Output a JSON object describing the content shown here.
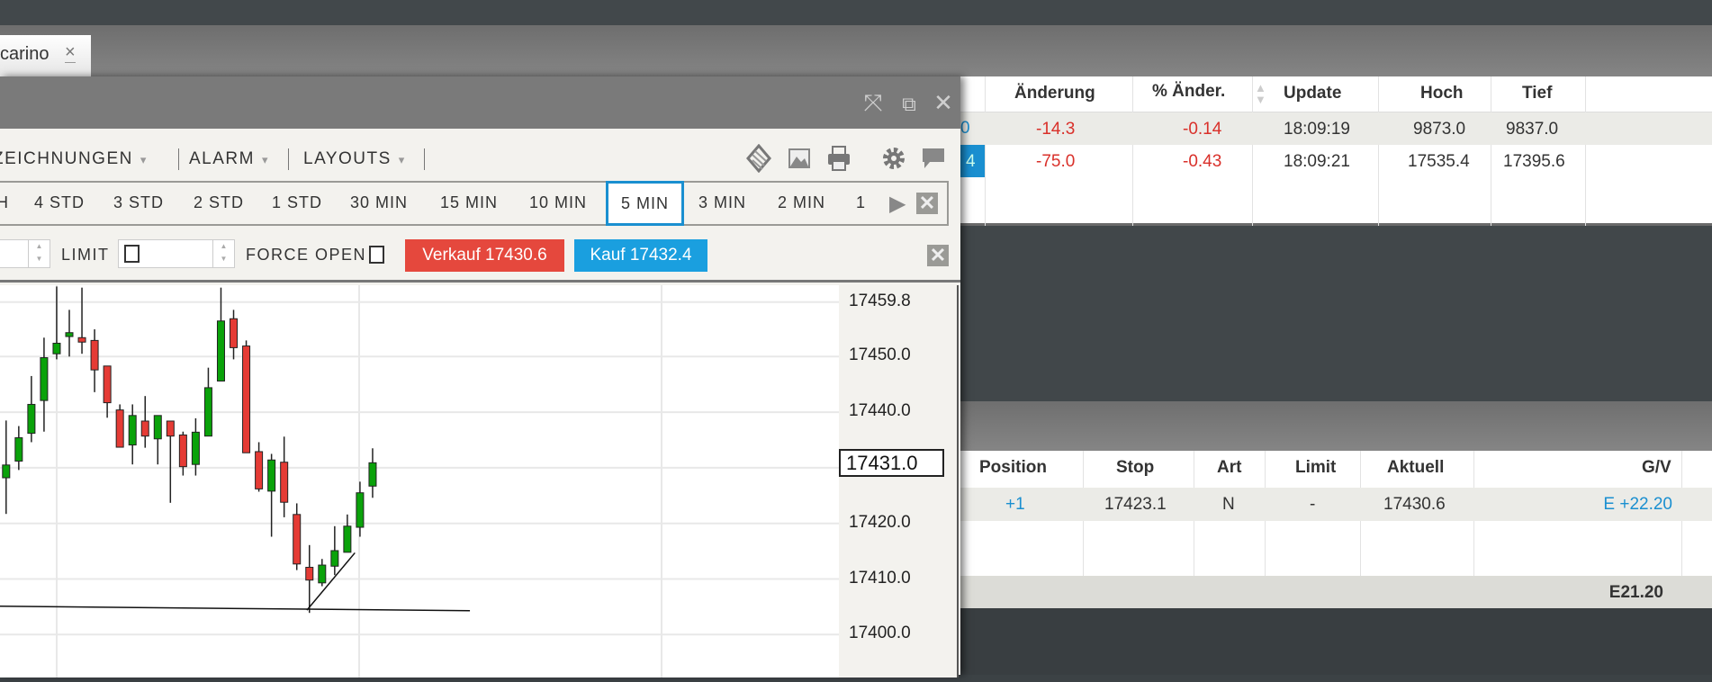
{
  "tab": {
    "label": "carino",
    "close": "×"
  },
  "window": {
    "icons": [
      "expand-icon",
      "popout-icon",
      "close-icon"
    ]
  },
  "toolbar": {
    "menus": [
      {
        "label": "ZEICHNUNGEN"
      },
      {
        "label": "ALARM"
      },
      {
        "label": "LAYOUTS"
      }
    ],
    "caret": "▾",
    "icons": [
      "indicator-icon",
      "image-icon",
      "print-icon",
      "gear-icon",
      "comment-icon"
    ]
  },
  "timeframes": {
    "items": [
      "H",
      "4 STD",
      "3 STD",
      "2 STD",
      "1 STD",
      "30 MIN",
      "15 MIN",
      "10 MIN",
      "5 MIN",
      "3 MIN",
      "2 MIN",
      "1"
    ],
    "selected": "5 MIN"
  },
  "order": {
    "limit_label": "LIMIT",
    "force_open_label": "FORCE OPEN",
    "sell_label": "Verkauf 17430.6",
    "buy_label": "Kauf 17432.4",
    "sell_color": "#e5483d",
    "buy_color": "#1a9fdf"
  },
  "chart_data": {
    "type": "candlestick",
    "interval": "5 MIN",
    "y_ticks": [
      "17459.8",
      "17450.0",
      "17440.0",
      "17430.0",
      "17420.0",
      "17410.0",
      "17400.0"
    ],
    "y_tick_labels": [
      "17459.8",
      "17450.0",
      "17440.0",
      "17420.0",
      "17410.0",
      "17400.0"
    ],
    "last_price": "17431.0",
    "ylim": [
      17395,
      17465
    ],
    "grid": true,
    "up_color": "#0aa20a",
    "down_color": "#e53b35",
    "candles": [
      {
        "o": 17428.2,
        "h": 17438.5,
        "l": 17421.7,
        "c": 17430.5
      },
      {
        "o": 17431.2,
        "h": 17437.5,
        "l": 17429.6,
        "c": 17435.4
      },
      {
        "o": 17436.2,
        "h": 17446.5,
        "l": 17434.6,
        "c": 17441.4
      },
      {
        "o": 17442.1,
        "h": 17453.4,
        "l": 17436.5,
        "c": 17449.8
      },
      {
        "o": 17450.5,
        "h": 17462.6,
        "l": 17449.5,
        "c": 17452.4
      },
      {
        "o": 17453.6,
        "h": 17458.4,
        "l": 17450.0,
        "c": 17454.3
      },
      {
        "o": 17453.4,
        "h": 17462.4,
        "l": 17450.5,
        "c": 17452.6
      },
      {
        "o": 17452.9,
        "h": 17454.9,
        "l": 17443.6,
        "c": 17447.6
      },
      {
        "o": 17448.3,
        "h": 17448.3,
        "l": 17439.0,
        "c": 17441.7
      },
      {
        "o": 17440.4,
        "h": 17441.4,
        "l": 17433.7,
        "c": 17433.7
      },
      {
        "o": 17434.1,
        "h": 17441.4,
        "l": 17430.6,
        "c": 17439.4
      },
      {
        "o": 17438.4,
        "h": 17442.9,
        "l": 17433.6,
        "c": 17435.7
      },
      {
        "o": 17435.2,
        "h": 17439.4,
        "l": 17430.6,
        "c": 17439.4
      },
      {
        "o": 17438.4,
        "h": 17438.4,
        "l": 17423.7,
        "c": 17435.7
      },
      {
        "o": 17435.9,
        "h": 17436.5,
        "l": 17428.6,
        "c": 17430.2
      },
      {
        "o": 17430.6,
        "h": 17438.9,
        "l": 17428.6,
        "c": 17436.4
      },
      {
        "o": 17435.7,
        "h": 17448.0,
        "l": 17435.7,
        "c": 17444.4
      },
      {
        "o": 17445.6,
        "h": 17462.4,
        "l": 17445.6,
        "c": 17456.4
      },
      {
        "o": 17456.8,
        "h": 17458.4,
        "l": 17449.5,
        "c": 17451.6
      },
      {
        "o": 17451.9,
        "h": 17452.9,
        "l": 17432.7,
        "c": 17432.7
      },
      {
        "o": 17432.9,
        "h": 17434.6,
        "l": 17425.7,
        "c": 17426.2
      },
      {
        "o": 17425.8,
        "h": 17432.5,
        "l": 17417.6,
        "c": 17431.4
      },
      {
        "o": 17431.0,
        "h": 17435.6,
        "l": 17421.1,
        "c": 17423.8
      },
      {
        "o": 17421.6,
        "h": 17423.6,
        "l": 17411.6,
        "c": 17412.7
      },
      {
        "o": 17412.1,
        "h": 17416.1,
        "l": 17403.9,
        "c": 17409.8
      },
      {
        "o": 17409.3,
        "h": 17413.6,
        "l": 17408.7,
        "c": 17412.5
      },
      {
        "o": 17412.3,
        "h": 17419.5,
        "l": 17410.7,
        "c": 17415.1
      },
      {
        "o": 17414.8,
        "h": 17421.6,
        "l": 17414.8,
        "c": 17419.5
      },
      {
        "o": 17419.3,
        "h": 17427.5,
        "l": 17417.6,
        "c": 17425.5
      },
      {
        "o": 17426.7,
        "h": 17433.5,
        "l": 17424.6,
        "c": 17430.9
      }
    ],
    "drawings": [
      {
        "type": "trendline",
        "from": [
          -0.5,
          17405.1
        ],
        "to": [
          36.7,
          17404.3
        ]
      },
      {
        "type": "trendline",
        "from": [
          23.8,
          17404.4
        ],
        "to": [
          27.6,
          17414.7
        ]
      }
    ]
  },
  "watchlist": {
    "headers": [
      "Änderung",
      "% Änder.",
      "Update",
      "Hoch",
      "Tief"
    ],
    "rows": [
      {
        "marker": "0",
        "change": "-14.3",
        "pct": "-0.14",
        "update": "18:09:19",
        "high": "9873.0",
        "low": "9837.0"
      },
      {
        "marker": "4",
        "change": "-75.0",
        "pct": "-0.43",
        "update": "18:09:21",
        "high": "17535.4",
        "low": "17395.6"
      }
    ]
  },
  "positions": {
    "headers": [
      "Position",
      "Stop",
      "Art",
      "Limit",
      "Aktuell",
      "G/V"
    ],
    "rows": [
      {
        "position": "+1",
        "stop": "17423.1",
        "art": "N",
        "limit": "-",
        "current": "17430.6",
        "pl": "E +22.20"
      }
    ],
    "total": "E21.20"
  }
}
